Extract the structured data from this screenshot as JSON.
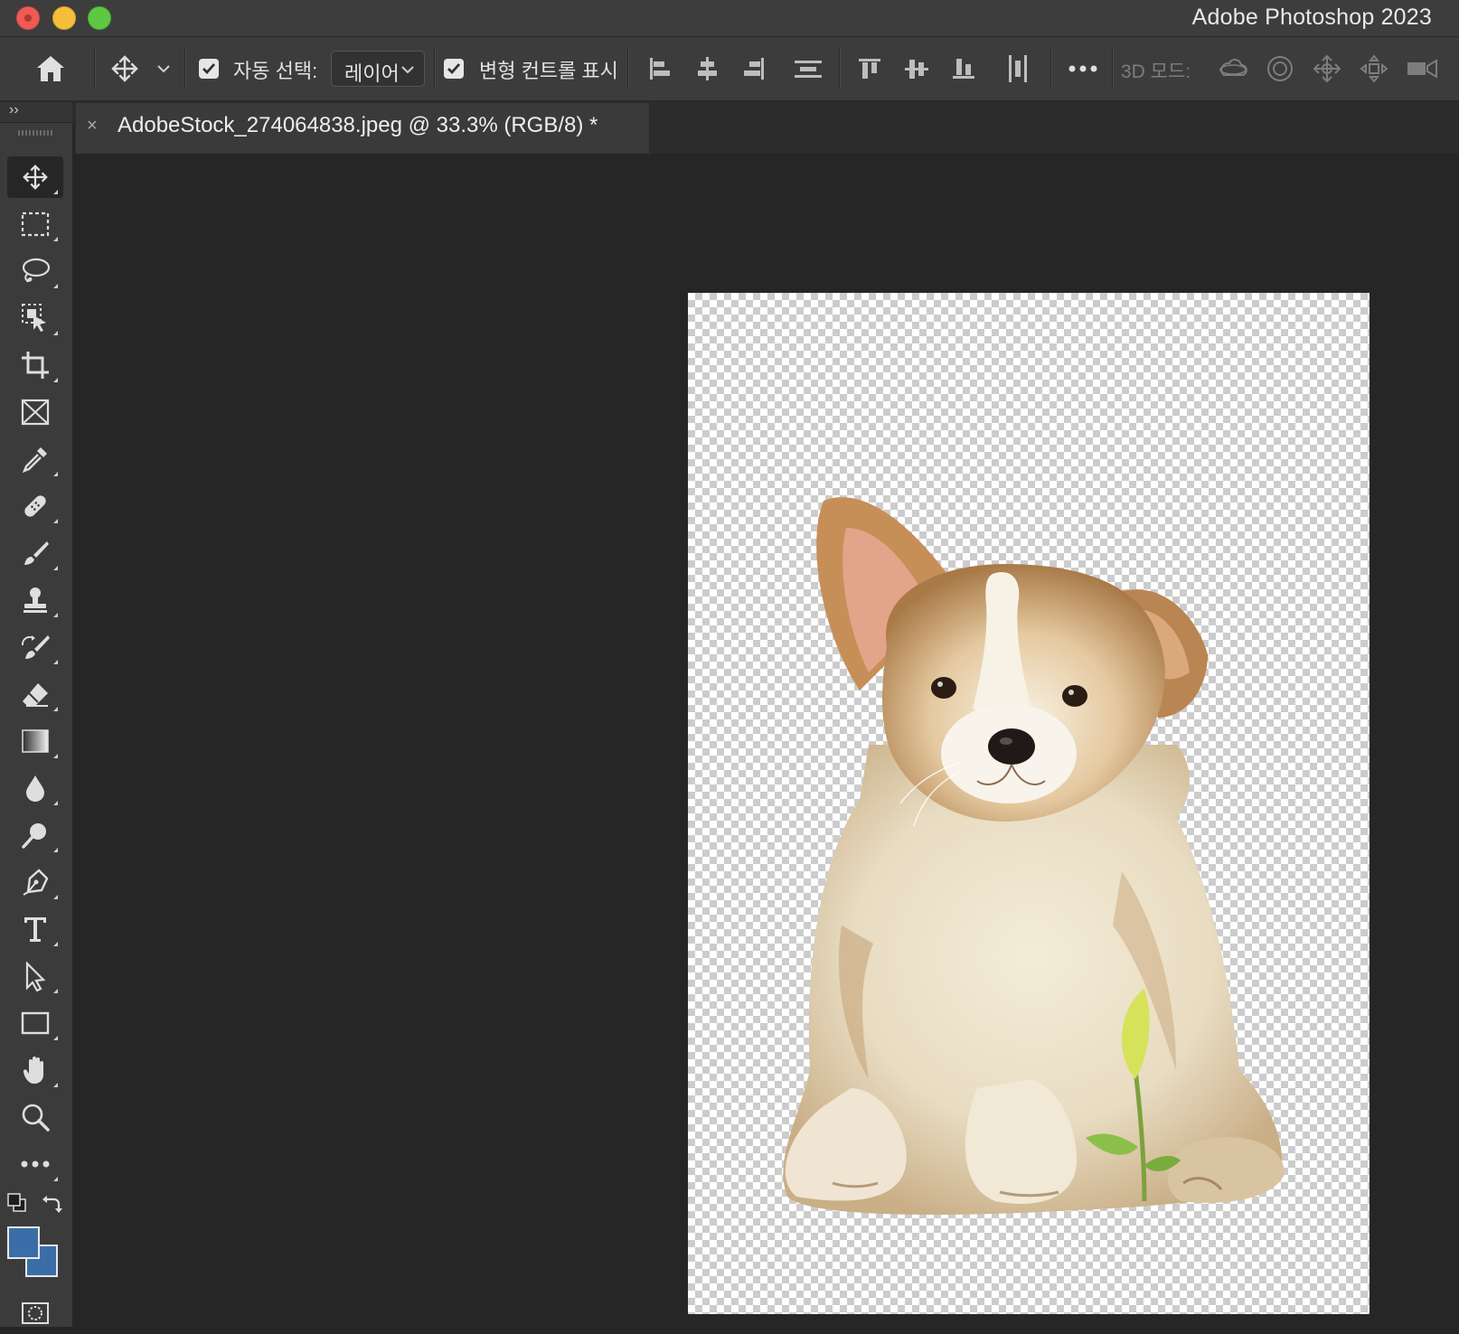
{
  "window": {
    "title": "Adobe Photoshop 2023"
  },
  "options_bar": {
    "home_icon": "home-icon",
    "move_tool_icon": "move-icon",
    "auto_select_label": "자동 선택:",
    "auto_select_checked": true,
    "auto_select_target": "레이어",
    "show_transform_label": "변형 컨트롤 표시",
    "show_transform_checked": true,
    "align_icons": [
      "align-left-edges-icon",
      "align-horizontal-centers-icon",
      "align-right-edges-icon",
      "distribute-vertical-icon",
      "align-top-edges-icon",
      "align-vertical-centers-icon",
      "align-bottom-edges-icon",
      "distribute-horizontal-icon"
    ],
    "more_icon": "more-options-icon",
    "mode_3d_label": "3D 모드:",
    "mode_3d_icons": [
      "orbit-3d-icon",
      "roll-3d-icon",
      "pan-3d-icon",
      "slide-3d-icon",
      "scale-3d-icon"
    ]
  },
  "panel_toggle": "››",
  "document_tab": {
    "close_glyph": "×",
    "name": "AdobeStock_274064838.jpeg @ 33.3% (RGB/8) *"
  },
  "toolbar": {
    "tools": [
      "move-tool-icon",
      "rectangular-marquee-icon",
      "lasso-icon",
      "object-selection-icon",
      "crop-icon",
      "frame-icon",
      "eyedropper-icon",
      "spot-healing-icon",
      "brush-icon",
      "clone-stamp-icon",
      "history-brush-icon",
      "eraser-icon",
      "gradient-icon",
      "blur-icon",
      "dodge-icon",
      "pen-icon",
      "type-icon",
      "path-selection-icon",
      "rectangle-icon",
      "hand-icon",
      "zoom-icon",
      "edit-toolbar-icon"
    ],
    "active_tool": "move-tool-icon",
    "foreground_color": "#3b6ea8",
    "background_color": "#3b6ea8"
  },
  "canvas": {
    "content": "corgi-puppy-cutout-on-transparent-background"
  },
  "colors": {
    "traffic_close": "#ee5b55",
    "traffic_minimize": "#f5be3a",
    "traffic_zoom": "#5ec842",
    "ui_background": "#262626",
    "panel_background": "#3c3c3c"
  }
}
